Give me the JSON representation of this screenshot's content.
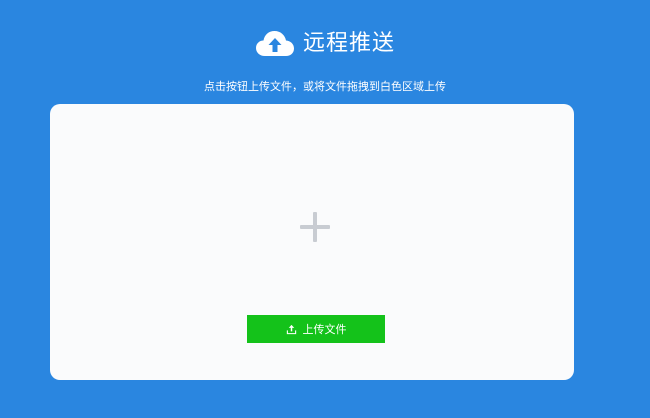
{
  "header": {
    "title": "远程推送"
  },
  "subtitle": "点击按钮上传文件，或将文件拖拽到白色区域上传",
  "dropzone": {
    "upload_button_label": "上传文件"
  },
  "colors": {
    "background": "#2a86e0",
    "dropzone": "#fafbfc",
    "button": "#14c21a",
    "plus": "#c8ccd2"
  },
  "icons": {
    "header": "cloud-upload-icon",
    "dropzone": "plus-icon",
    "button": "upload-icon"
  }
}
